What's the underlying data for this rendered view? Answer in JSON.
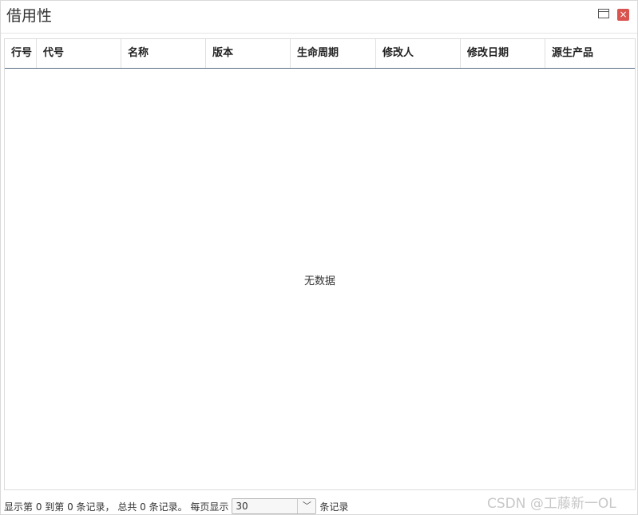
{
  "window": {
    "title": "借用性",
    "close_glyph": "×"
  },
  "table": {
    "columns": [
      "行号",
      "代号",
      "名称",
      "版本",
      "生命周期",
      "修改人",
      "修改日期",
      "源生产品"
    ],
    "empty_text": "无数据"
  },
  "pager": {
    "summary": "显示第 0 到第 0 条记录， 总共 0 条记录。 每页显示",
    "page_size": "30",
    "suffix": "条记录",
    "chevron": "﹀"
  },
  "watermark": "CSDN @工藤新一OL",
  "icons": {
    "maximize": "maximize-icon",
    "close": "close-icon",
    "dropdown": "chevron-down-icon"
  }
}
